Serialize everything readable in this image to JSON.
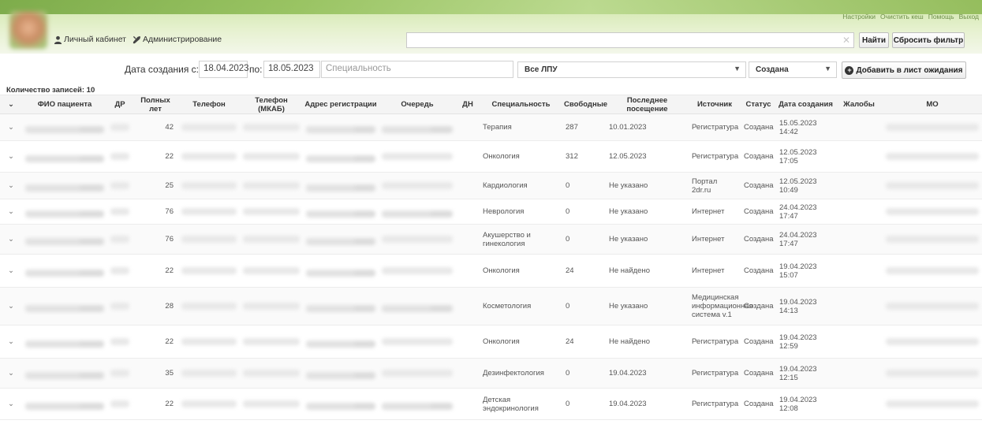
{
  "header": {
    "top_links": [
      "Настройки",
      "Очистить кеш",
      "Помощь",
      "Выход"
    ],
    "nav": [
      {
        "label": "Личный кабинет",
        "icon": "user-icon"
      },
      {
        "label": "Администрирование",
        "icon": "gear-icon"
      }
    ],
    "search_value": "",
    "find_label": "Найти",
    "reset_label": "Сбросить фильтр"
  },
  "filters": {
    "date_from_label": "Дата создания с:",
    "date_from": "18.04.2023",
    "date_to_label": "по:",
    "date_to": "18.05.2023",
    "specialty_placeholder": "Специальность",
    "lpu": "Все ЛПУ",
    "status": "Создана",
    "add_label": "Добавить в лист ожидания"
  },
  "count_label": "Количество записей: 10",
  "table": {
    "columns": [
      "",
      "ФИО пациента",
      "ДР",
      "Полных лет",
      "Телефон",
      "Телефон (МКАБ)",
      "Адрес регистрации",
      "Очередь",
      "ДН",
      "Специальность",
      "Свободные",
      "Последнее посещение",
      "Источник",
      "Статус",
      "Дата создания",
      "Жалобы",
      "МО"
    ],
    "rows": [
      {
        "age": "42",
        "specialty": "Терапия",
        "free": "287",
        "last_visit": "10.01.2023",
        "source": "Регистратура",
        "status": "Создана",
        "created": "15.05.2023 14:42"
      },
      {
        "age": "22",
        "specialty": "Онкология",
        "free": "312",
        "last_visit": "12.05.2023",
        "source": "Регистратура",
        "status": "Создана",
        "created": "12.05.2023 17:05"
      },
      {
        "age": "25",
        "specialty": "Кардиология",
        "free": "0",
        "last_visit": "Не указано",
        "source": "Портал 2dr.ru",
        "status": "Создана",
        "created": "12.05.2023 10:49"
      },
      {
        "age": "76",
        "specialty": "Неврология",
        "free": "0",
        "last_visit": "Не указано",
        "source": "Интернет",
        "status": "Создана",
        "created": "24.04.2023 17:47"
      },
      {
        "age": "76",
        "specialty": "Акушерство и гинекология",
        "free": "0",
        "last_visit": "Не указано",
        "source": "Интернет",
        "status": "Создана",
        "created": "24.04.2023 17:47"
      },
      {
        "age": "22",
        "specialty": "Онкология",
        "free": "24",
        "last_visit": "Не найдено",
        "source": "Интернет",
        "status": "Создана",
        "created": "19.04.2023 15:07"
      },
      {
        "age": "28",
        "specialty": "Косметология",
        "free": "0",
        "last_visit": "Не указано",
        "source": "Медицинская информационная система v.1",
        "status": "Создана",
        "created": "19.04.2023 14:13"
      },
      {
        "age": "22",
        "specialty": "Онкология",
        "free": "24",
        "last_visit": "Не найдено",
        "source": "Регистратура",
        "status": "Создана",
        "created": "19.04.2023 12:59"
      },
      {
        "age": "35",
        "specialty": "Дезинфектология",
        "free": "0",
        "last_visit": "19.04.2023",
        "source": "Регистратура",
        "status": "Создана",
        "created": "19.04.2023 12:15"
      },
      {
        "age": "22",
        "specialty": "Детская эндокринология",
        "free": "0",
        "last_visit": "19.04.2023",
        "source": "Регистратура",
        "status": "Создана",
        "created": "19.04.2023 12:08"
      }
    ]
  },
  "colors": {
    "header_green": "#8fbd55",
    "link_green": "#6d8f4a"
  }
}
